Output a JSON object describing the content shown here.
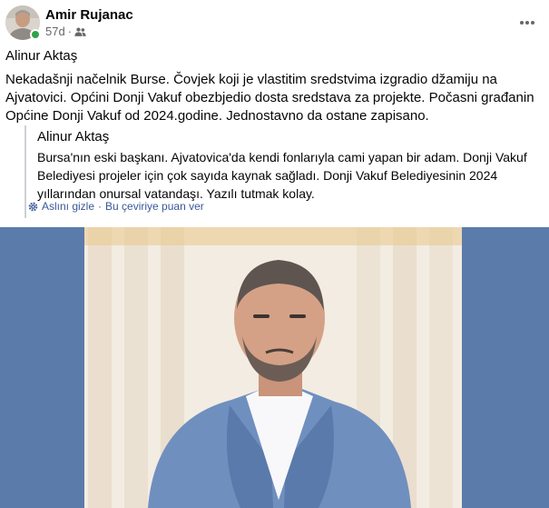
{
  "post": {
    "author": "Amir Rujanac",
    "time": "57d",
    "meta_separator": "·",
    "audience_icon": "friends-icon",
    "shared_by": "Alinur Aktaş",
    "text": "Nekadašnji načelnik Burse. Čovjek koji je vlastitim sredstvima izgradio džamiju na Ajvatovici. Općini Donji Vakuf obezbjedio dosta sredstava za projekte. Počasni građanin Općine Donji Vakuf od 2024.godine. Jednostavno da ostane zapisano.",
    "translation": {
      "author": "Alinur Aktaş",
      "text": "Bursa'nın eski başkanı. Ajvatovica'da kendi fonlarıyla cami yapan bir adam. Donji Vakuf Belediyesi projeler için çok sayıda kaynak sağladı. Donji Vakuf Belediyesinin 2024 yıllarından onursal vatandaşı. Yazılı tutmak kolay.",
      "hide_original_label": "Aslını gizle",
      "separator": "·",
      "rate_translation_label": "Bu çeviriye puan ver"
    }
  },
  "colors": {
    "link": "#385898",
    "secondary_text": "#65676b",
    "online": "#31a24c",
    "photo_background": "#5b7bab"
  }
}
